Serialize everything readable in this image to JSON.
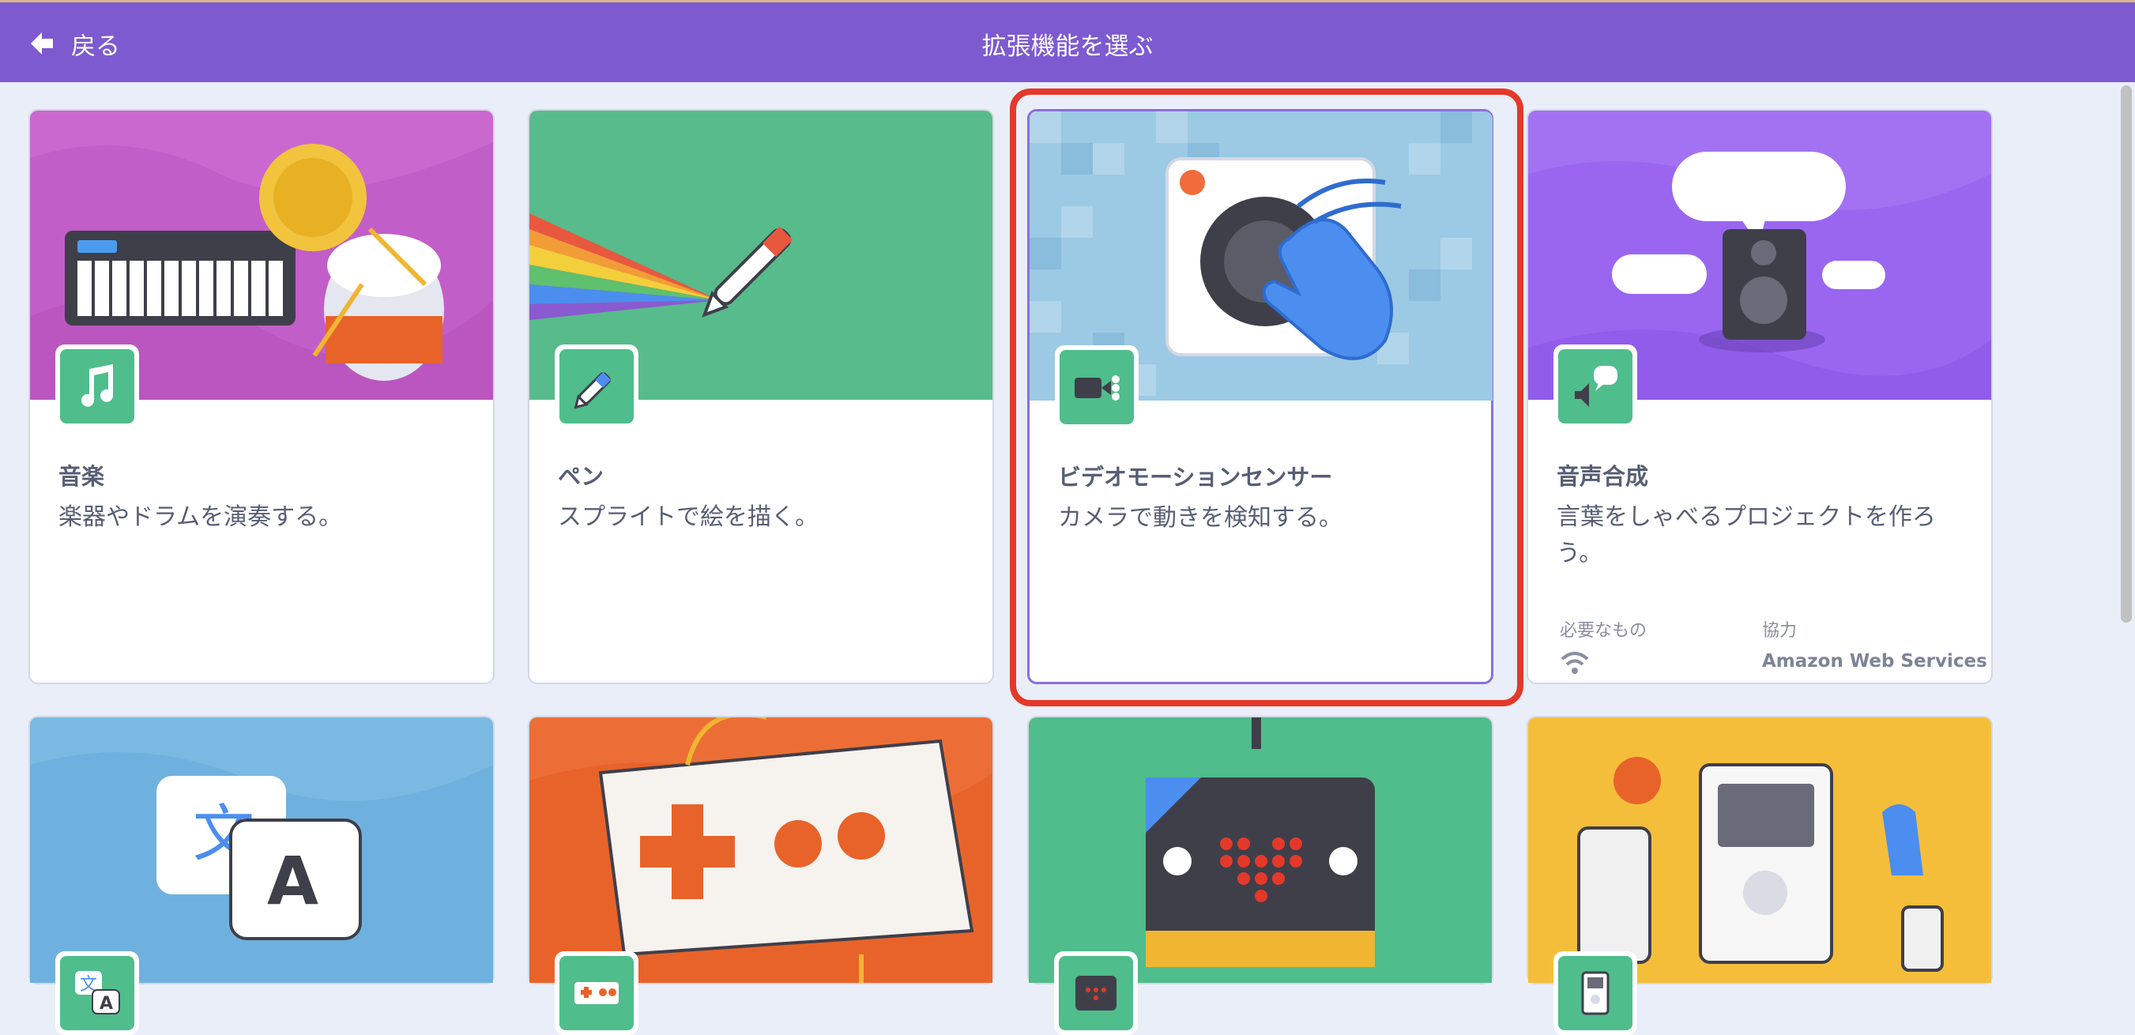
{
  "header": {
    "back_label": "戻る",
    "title": "拡張機能を選ぶ"
  },
  "cards": [
    {
      "name": "音楽",
      "description": "楽器やドラムを演奏する。"
    },
    {
      "name": "ペン",
      "description": "スプライトで絵を描く。"
    },
    {
      "name": "ビデオモーションセンサー",
      "description": "カメラで動きを検知する。"
    },
    {
      "name": "音声合成",
      "description": "言葉をしゃべるプロジェクトを作ろう。",
      "requires_label": "必要なもの",
      "collaborator_label": "協力",
      "collaborator": "Amazon Web Services"
    }
  ],
  "bottom_row_icons": [
    "translate-icon",
    "makeymakey-icon",
    "microbit-icon",
    "ev3-icon"
  ],
  "colors": {
    "header": "#7d5ad0",
    "accent_green": "#4fbd8c",
    "highlight": "#e4392a"
  }
}
